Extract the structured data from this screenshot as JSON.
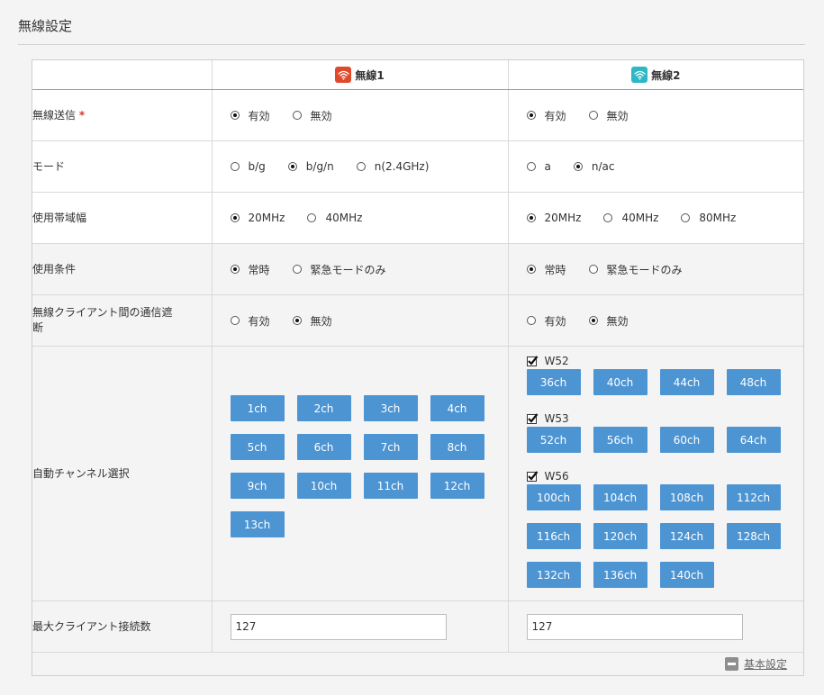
{
  "page": {
    "title": "無線設定"
  },
  "header": {
    "wireless1": {
      "label": "無線1",
      "color": "#e04a2b",
      "icon": "wifi-icon"
    },
    "wireless2": {
      "label": "無線2",
      "color": "#2db8c5",
      "icon": "wifi-icon"
    }
  },
  "rows": {
    "tx": {
      "label": "無線送信",
      "required_mark": "*",
      "w1": [
        {
          "label": "有効",
          "checked": true
        },
        {
          "label": "無効",
          "checked": false
        }
      ],
      "w2": [
        {
          "label": "有効",
          "checked": true
        },
        {
          "label": "無効",
          "checked": false
        }
      ]
    },
    "mode": {
      "label": "モード",
      "w1": [
        {
          "label": "b/g",
          "checked": false
        },
        {
          "label": "b/g/n",
          "checked": true
        },
        {
          "label": "n(2.4GHz)",
          "checked": false
        }
      ],
      "w2": [
        {
          "label": "a",
          "checked": false
        },
        {
          "label": "n/ac",
          "checked": true
        }
      ]
    },
    "bandwidth": {
      "label": "使用帯域幅",
      "w1": [
        {
          "label": "20MHz",
          "checked": true
        },
        {
          "label": "40MHz",
          "checked": false
        }
      ],
      "w2": [
        {
          "label": "20MHz",
          "checked": true
        },
        {
          "label": "40MHz",
          "checked": false
        },
        {
          "label": "80MHz",
          "checked": false
        }
      ]
    },
    "condition": {
      "label": "使用条件",
      "w1": [
        {
          "label": "常時",
          "checked": true
        },
        {
          "label": "緊急モードのみ",
          "checked": false
        }
      ],
      "w2": [
        {
          "label": "常時",
          "checked": true
        },
        {
          "label": "緊急モードのみ",
          "checked": false
        }
      ]
    },
    "isolation": {
      "label": "無線クライアント間の通信遮断",
      "w1": [
        {
          "label": "有効",
          "checked": false
        },
        {
          "label": "無効",
          "checked": true
        }
      ],
      "w2": [
        {
          "label": "有効",
          "checked": false
        },
        {
          "label": "無効",
          "checked": true
        }
      ]
    },
    "auto_channel": {
      "label": "自動チャンネル選択",
      "w1_channels": [
        "1ch",
        "2ch",
        "3ch",
        "4ch",
        "5ch",
        "6ch",
        "7ch",
        "8ch",
        "9ch",
        "10ch",
        "11ch",
        "12ch",
        "13ch"
      ],
      "w2_bands": [
        {
          "name": "W52",
          "checked": true,
          "channels": [
            "36ch",
            "40ch",
            "44ch",
            "48ch"
          ]
        },
        {
          "name": "W53",
          "checked": true,
          "channels": [
            "52ch",
            "56ch",
            "60ch",
            "64ch"
          ]
        },
        {
          "name": "W56",
          "checked": true,
          "channels": [
            "100ch",
            "104ch",
            "108ch",
            "112ch",
            "116ch",
            "120ch",
            "124ch",
            "128ch",
            "132ch",
            "136ch",
            "140ch"
          ]
        }
      ]
    },
    "max_clients": {
      "label": "最大クライアント接続数",
      "w1_value": "127",
      "w2_value": "127"
    }
  },
  "footer": {
    "link_label": "基本設定",
    "icon": "minus-icon"
  }
}
